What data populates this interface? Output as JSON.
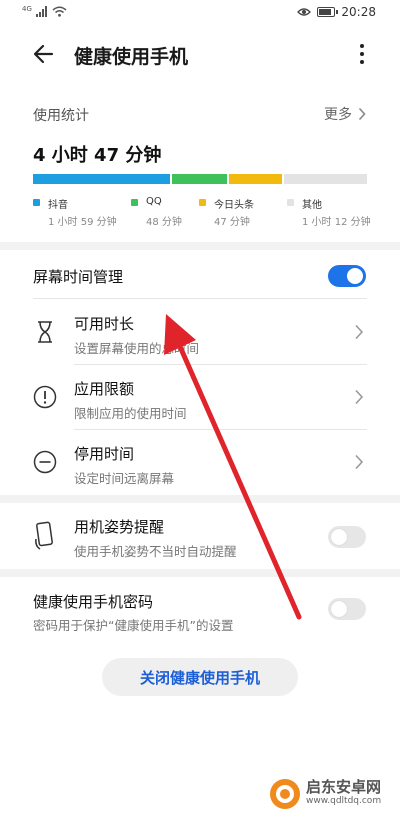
{
  "status_bar": {
    "network": "4G",
    "time": "20:28"
  },
  "header": {
    "title": "健康使用手机"
  },
  "stats": {
    "label": "使用统计",
    "more_label": "更多",
    "total": "4 小时 47 分钟",
    "apps": [
      {
        "name": "抖音",
        "duration": "1 小时 59 分钟",
        "minutes": 119,
        "color": "#1c9ee0"
      },
      {
        "name": "QQ",
        "duration": "48 分钟",
        "minutes": 48,
        "color": "#3ec15a"
      },
      {
        "name": "今日头条",
        "duration": "47 分钟",
        "minutes": 47,
        "color": "#f2b90f"
      },
      {
        "name": "其他",
        "duration": "1 小时 12 分钟",
        "minutes": 72,
        "color": "#e3e3e3"
      }
    ]
  },
  "screen_time": {
    "title": "屏幕时间管理",
    "enabled": true,
    "items": [
      {
        "title": "可用时长",
        "subtitle": "设置屏幕使用的总时间"
      },
      {
        "title": "应用限额",
        "subtitle": "限制应用的使用时间"
      },
      {
        "title": "停用时间",
        "subtitle": "设定时间远离屏幕"
      }
    ]
  },
  "posture": {
    "title": "用机姿势提醒",
    "subtitle": "使用手机姿势不当时自动提醒",
    "enabled": false
  },
  "password": {
    "title": "健康使用手机密码",
    "subtitle": "密码用于保护“健康使用手机”的设置",
    "enabled": false
  },
  "close_button": {
    "label": "关闭健康使用手机"
  },
  "watermark": {
    "name": "启东安卓网",
    "url": "www.qdltdq.com"
  },
  "colors": {
    "accent": "#1d74e8",
    "annotation_arrow": "#e0242c"
  }
}
